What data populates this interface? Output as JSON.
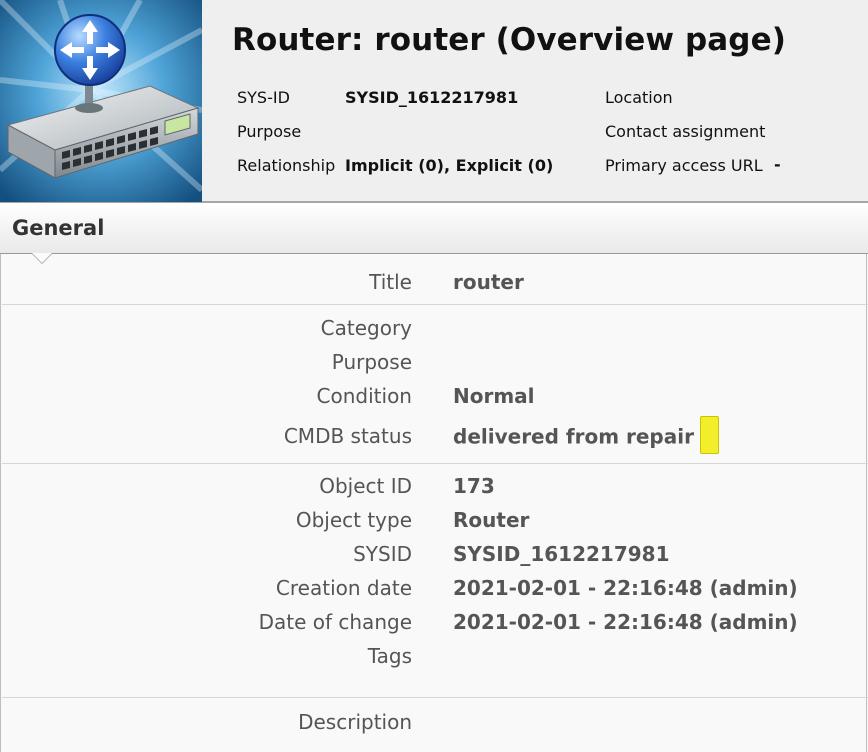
{
  "header": {
    "title": "Router: router (Overview page)",
    "object_image_icon": "router-device-icon",
    "sysid_label": "SYS-ID",
    "sysid_value": "SYSID_1612217981",
    "purpose_label": "Purpose",
    "relationship_label": "Relationship",
    "relationship_value": "Implicit (0), Explicit (0)",
    "location_label": "Location",
    "contact_label": "Contact assignment",
    "access_url_label": "Primary access URL",
    "access_url_value": "-"
  },
  "section": {
    "title": "General"
  },
  "fields": {
    "title": {
      "label": "Title",
      "value": "router"
    },
    "category": {
      "label": "Category",
      "value": ""
    },
    "purpose": {
      "label": "Purpose",
      "value": ""
    },
    "condition": {
      "label": "Condition",
      "value": "Normal"
    },
    "cmdb_status": {
      "label": "CMDB status",
      "value": "delivered from repair",
      "color": "#f2ee2a"
    },
    "object_id": {
      "label": "Object ID",
      "value": "173"
    },
    "object_type": {
      "label": "Object type",
      "value": "Router"
    },
    "sysid": {
      "label": "SYSID",
      "value": "SYSID_1612217981"
    },
    "creation_date": {
      "label": "Creation date",
      "value": "2021-02-01 - 22:16:48 (admin)"
    },
    "date_of_change": {
      "label": "Date of change",
      "value": "2021-02-01 - 22:16:48 (admin)"
    },
    "tags": {
      "label": "Tags",
      "value": ""
    },
    "description": {
      "label": "Description",
      "value": ""
    }
  }
}
